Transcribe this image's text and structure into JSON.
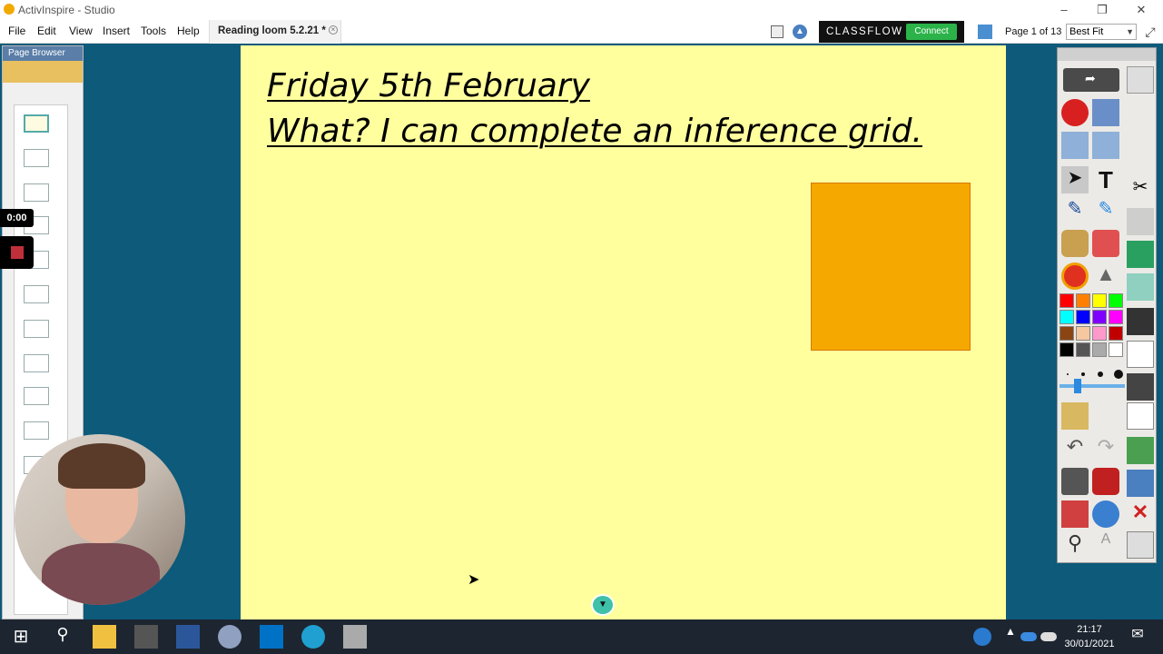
{
  "window": {
    "title": "ActivInspire - Studio"
  },
  "menu": {
    "items": [
      "File",
      "Edit",
      "View",
      "Insert",
      "Tools",
      "Help"
    ]
  },
  "document_tab": {
    "label": "Reading loom 5.2.21 *"
  },
  "classflow": {
    "label": "CLASSFLOW",
    "connect_label": "Connect"
  },
  "page_indicator": "Page 1 of 13",
  "zoom": {
    "selected": "Best Fit"
  },
  "page_browser": {
    "title": "Page Browser"
  },
  "recording": {
    "timer": "0:00"
  },
  "flipchart": {
    "heading_line1": "Friday 5th February",
    "heading_line2": "What? I can complete an inference grid.",
    "shape_color": "#f5a800"
  },
  "toolbox": {
    "palette": [
      "#ff0000",
      "#ff8000",
      "#ffff00",
      "#00ff00",
      "#00ffff",
      "#0000ff",
      "#8000ff",
      "#ff00ff",
      "#8b4513",
      "#f5c8a0",
      "#ff99cc",
      "#c00000",
      "#000000",
      "#555555",
      "#aaaaaa",
      "#ffffff"
    ]
  },
  "taskbar": {
    "time": "21:17",
    "date": "30/01/2021"
  }
}
